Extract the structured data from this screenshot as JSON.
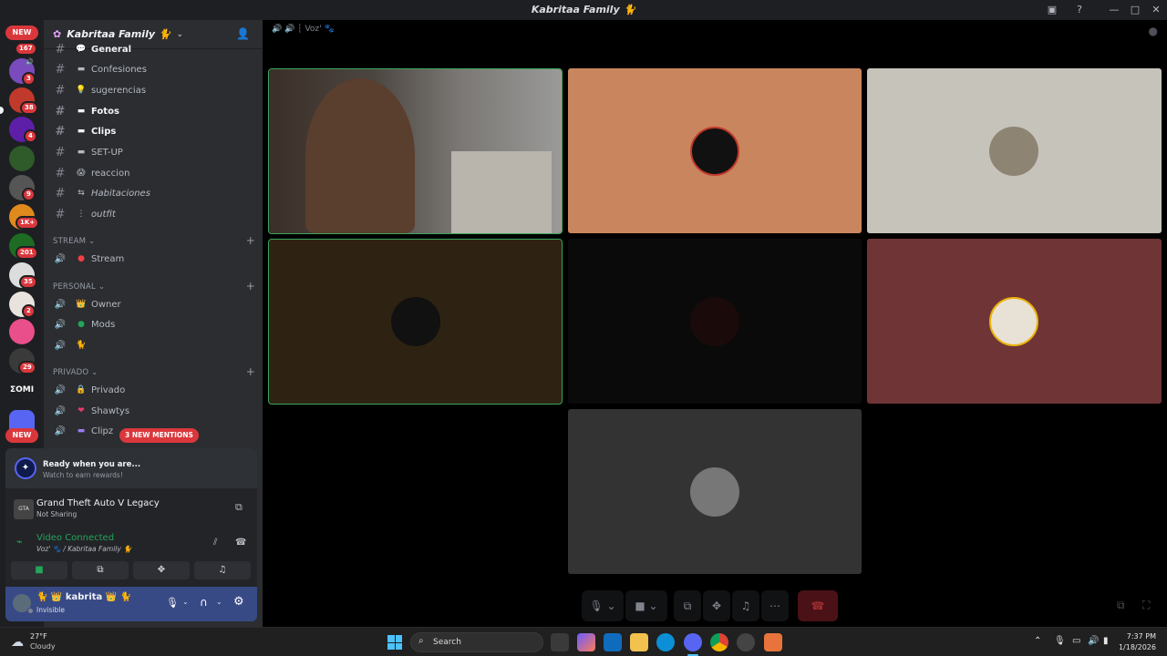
{
  "window": {
    "title": "Kabritaa Family 🐈"
  },
  "servers": {
    "new_top": "NEW",
    "new_bottom": "NEW",
    "badges": [
      "167",
      "3",
      "38",
      "4",
      "9",
      "1K+",
      "201",
      "35",
      "2",
      "29"
    ]
  },
  "server_header": {
    "name": "Kabritaa Family 🐈"
  },
  "channels": [
    {
      "name": "General",
      "icon": "💬"
    },
    {
      "name": "Confesiones",
      "icon": "▬"
    },
    {
      "name": "sugerencias",
      "icon": "💡"
    },
    {
      "name": "Fotos",
      "icon": "▬"
    },
    {
      "name": "Clips",
      "icon": "▬"
    },
    {
      "name": "SET-UP",
      "icon": "▬"
    },
    {
      "name": "reaccion",
      "icon": "😱"
    },
    {
      "name": "Habitaciones",
      "icon": "⇆"
    },
    {
      "name": "outfit",
      "icon": "⋮"
    }
  ],
  "categories": {
    "stream": "STREAM",
    "personal": "PERSONAL",
    "privado": "PRIVADO"
  },
  "voice_channels": {
    "stream": [
      {
        "name": "Stream",
        "icon": "●"
      }
    ],
    "personal": [
      {
        "name": "Owner",
        "icon": "👑"
      },
      {
        "name": "Mods",
        "icon": "●"
      },
      {
        "name": "",
        "icon": "🐈"
      }
    ],
    "privado": [
      {
        "name": "Privado",
        "icon": "🔒"
      },
      {
        "name": "Shawtys",
        "icon": "❤"
      },
      {
        "name": "Clipz",
        "icon": "▬"
      }
    ]
  },
  "mentions_pill": "3 NEW MENTIONS",
  "quest": {
    "title": "Ready when you are...",
    "subtitle": "Watch to earn rewards!"
  },
  "activity": {
    "game": "Grand Theft Auto V Legacy",
    "status": "Not Sharing"
  },
  "voice_status": {
    "label": "Video Connected",
    "location": "Voz' 🐾 / Kabritaa Family 🐈"
  },
  "user": {
    "name": "🐈 👑 kabrita 👑 🐈",
    "status": "Invisible"
  },
  "stage": {
    "header": "Voz' 🐾"
  },
  "tiles": [
    {
      "label": "camera-feed",
      "color": "#3a3d44"
    },
    {
      "label": "avatar",
      "color": "#c9855e"
    },
    {
      "label": "avatar",
      "color": "#c6c3bb"
    },
    {
      "label": "avatar",
      "color": "#2e2312"
    },
    {
      "label": "avatar",
      "color": "#0a0a0a"
    },
    {
      "label": "avatar",
      "color": "#6f3536"
    },
    {
      "label": "avatar",
      "color": "#333333"
    }
  ],
  "taskbar": {
    "temp": "27°F",
    "weather": "Cloudy",
    "search": "Search",
    "time": "7:37 PM",
    "date": "1/18/2026"
  }
}
